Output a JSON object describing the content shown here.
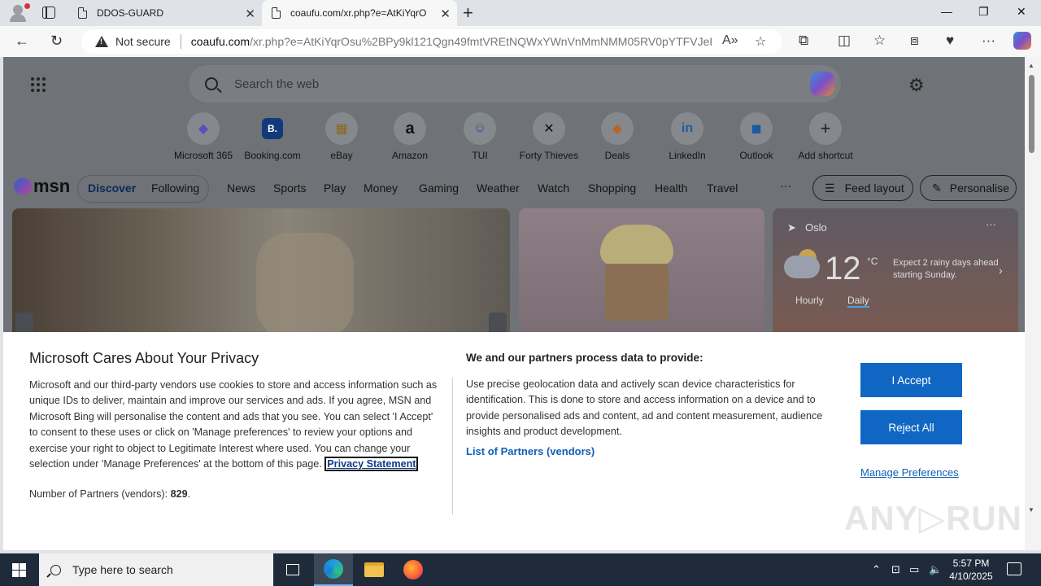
{
  "browser": {
    "tabs": [
      {
        "title": "DDOS-GUARD"
      },
      {
        "title": "coaufu.com/xr.php?e=AtKiYqrO"
      }
    ],
    "security_label": "Not secure",
    "url_host": "coaufu.com",
    "url_rest": "/xr.php?e=AtKiYqrOsu%2BPy9kl121Qgn49fmtVREtNQWxYWnVnMmNMM05RV0pYTFVJeE..."
  },
  "newtab": {
    "search_placeholder": "Search the web",
    "shortcuts": [
      {
        "label": "Microsoft 365",
        "glyph": "◆"
      },
      {
        "label": "Booking.com",
        "glyph": "B."
      },
      {
        "label": "eBay",
        "glyph": "▦"
      },
      {
        "label": "Amazon",
        "glyph": "a"
      },
      {
        "label": "TUI",
        "glyph": "☺"
      },
      {
        "label": "Forty Thieves",
        "glyph": "✕"
      },
      {
        "label": "Deals",
        "glyph": "◆"
      },
      {
        "label": "LinkedIn",
        "glyph": "in"
      },
      {
        "label": "Outlook",
        "glyph": "◼"
      },
      {
        "label": "Add shortcut",
        "glyph": "+"
      }
    ]
  },
  "msn": {
    "logo": "msn",
    "tabs": {
      "discover": "Discover",
      "following": "Following"
    },
    "nav": [
      "News",
      "Sports",
      "Play",
      "Money",
      "Gaming",
      "Weather",
      "Watch",
      "Shopping",
      "Health",
      "Travel"
    ],
    "more": "···",
    "feed_layout": "Feed layout",
    "personalise": "Personalise"
  },
  "weather": {
    "city": "Oslo",
    "temp": "12",
    "unit": "°C",
    "note": "Expect 2 rainy days ahead starting Sunday.",
    "hourly": "Hourly",
    "daily": "Daily"
  },
  "privacy": {
    "title": "Microsoft Cares About Your Privacy",
    "body": "Microsoft and our third-party vendors use cookies to store and access information such as unique IDs to deliver, maintain and improve our services and ads. If you agree, MSN and Microsoft Bing will personalise the content and ads that you see. You can select 'I Accept' to consent to these uses or click on 'Manage preferences' to review your options and exercise your right to object to Legitimate Interest where used.  You can change your selection under 'Manage Preferences' at the bottom of this page.",
    "privacy_link": "Privacy Statement",
    "partners_count_label": "Number of Partners (vendors):",
    "partners_count": "829",
    "process_heading": "We and our partners process data to provide:",
    "process_text": "Use precise geolocation data and actively scan device characteristics for identification. This is done to store and access information on a device and to provide personalised ads and content, ad and content measurement, audience insights and product development.",
    "partners_link": "List of Partners (vendors)",
    "accept": "I Accept",
    "reject": "Reject All",
    "manage": "Manage Preferences"
  },
  "taskbar": {
    "search_placeholder": "Type here to search",
    "time": "5:57 PM",
    "date": "4/10/2025"
  },
  "colors": {
    "accent": "#0f67c3",
    "link": "#0f5fb8",
    "taskbar": "#1f2b3a"
  }
}
